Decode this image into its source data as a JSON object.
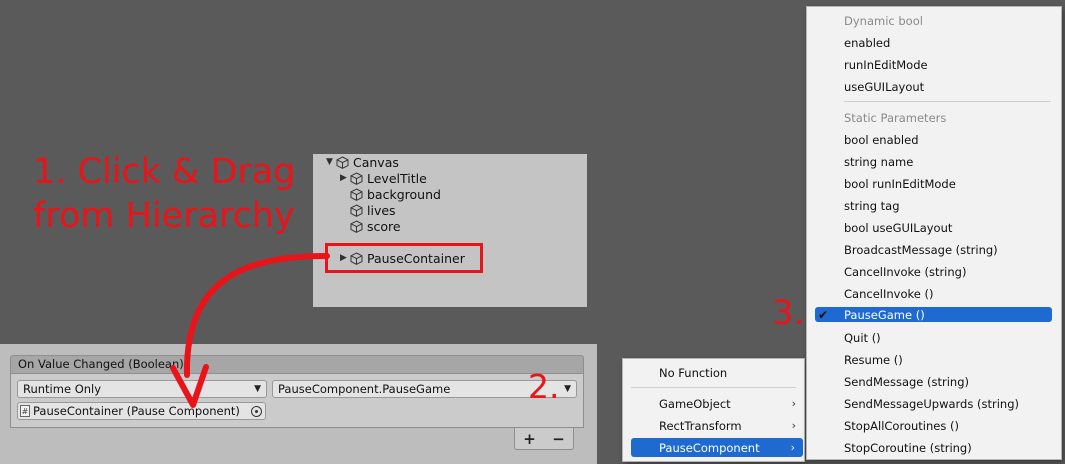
{
  "annotations": {
    "step1_line1": "1. Click & Drag",
    "step1_line2": "from Hierarchy",
    "step2": "2.",
    "step3": "3."
  },
  "colors": {
    "annotation": "#e8141a",
    "selection": "#1e6ad1",
    "panel": "#bdbdbd"
  },
  "hierarchy": {
    "root": "Canvas",
    "items": [
      "LevelTitle",
      "background",
      "lives",
      "score",
      "PauseContainer"
    ]
  },
  "event": {
    "header": "On Value Changed (Boolean)",
    "runtime_mode": "Runtime Only",
    "function": "PauseComponent.PauseGame",
    "object": "PauseContainer (Pause Component)",
    "add_label": "+",
    "remove_label": "−"
  },
  "menu1": {
    "items": [
      "No Function",
      "GameObject",
      "RectTransform",
      "PauseComponent"
    ]
  },
  "menu2": {
    "dynamic_header": "Dynamic bool",
    "dynamic_items": [
      "enabled",
      "runInEditMode",
      "useGUILayout"
    ],
    "static_header": "Static Parameters",
    "static_items": [
      "bool enabled",
      "string name",
      "bool runInEditMode",
      "string tag",
      "bool useGUILayout",
      "BroadcastMessage (string)",
      "CancelInvoke (string)",
      "CancelInvoke ()",
      "PauseGame ()",
      "Quit ()",
      "Resume ()",
      "SendMessage (string)",
      "SendMessageUpwards (string)",
      "StopAllCoroutines ()",
      "StopCoroutine (string)"
    ],
    "checkmark": "✔"
  }
}
